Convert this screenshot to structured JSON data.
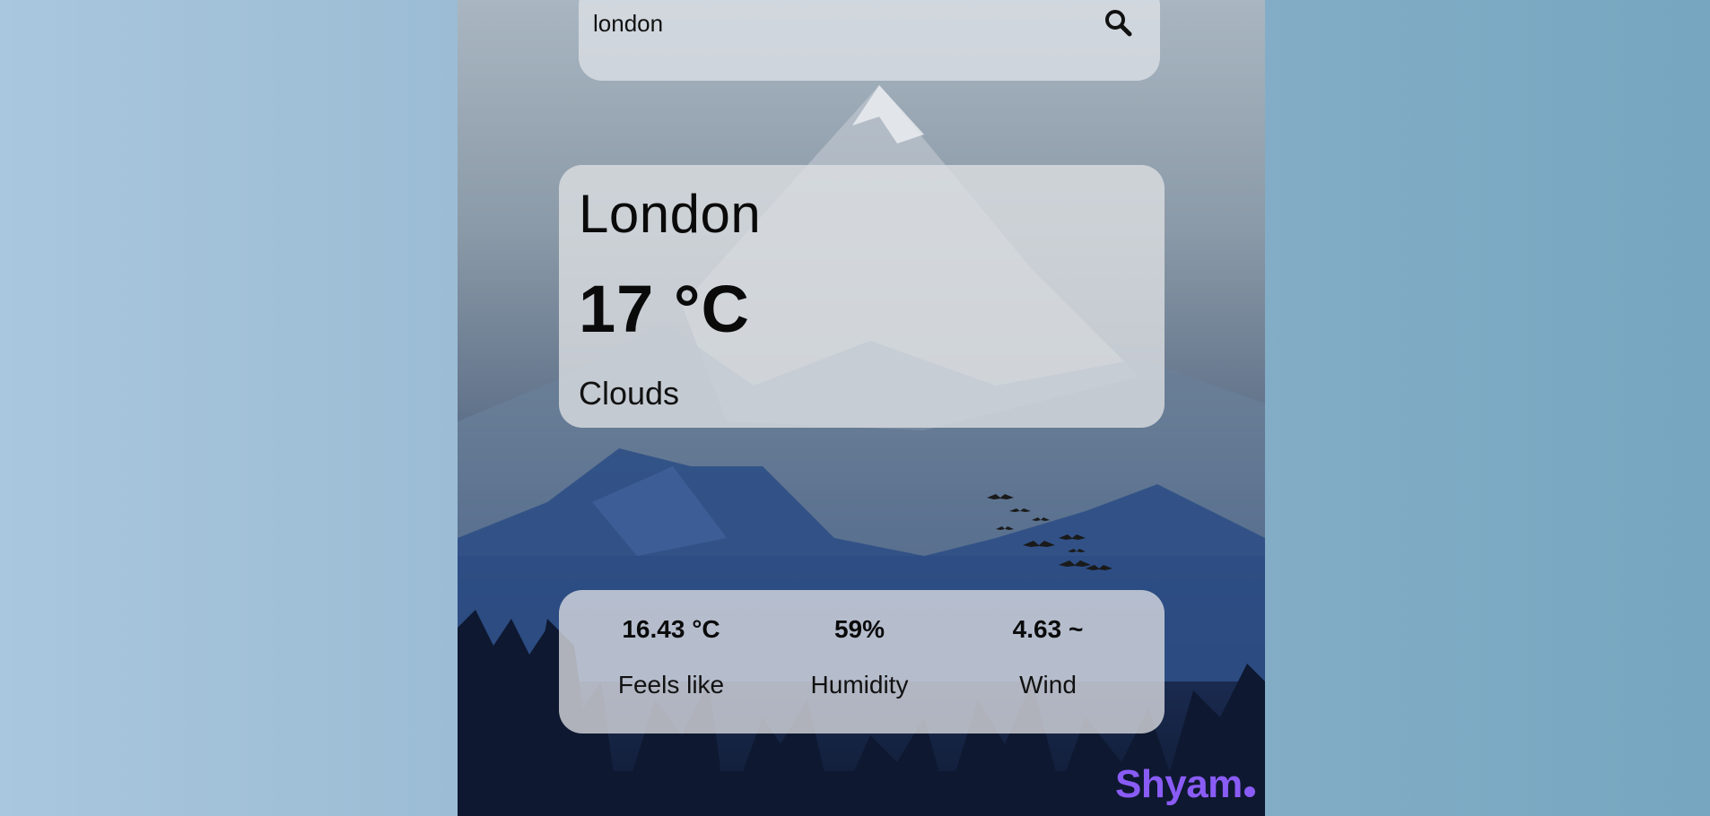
{
  "search": {
    "value": "london",
    "placeholder": "",
    "icon": "search-icon"
  },
  "weather": {
    "city": "London",
    "temperature": "17 °C",
    "description": "Clouds"
  },
  "stats": {
    "feels_like": {
      "value": "16.43 °C",
      "label": "Feels like"
    },
    "humidity": {
      "value": "59%",
      "label": "Humidity"
    },
    "wind": {
      "value": "4.63 ~",
      "label": "Wind"
    }
  },
  "brand": {
    "name": "Shyam",
    "color": "#8a5cf6"
  },
  "theme": {
    "card_background": "#dfe1e4",
    "text_color": "#0a0a0a"
  }
}
